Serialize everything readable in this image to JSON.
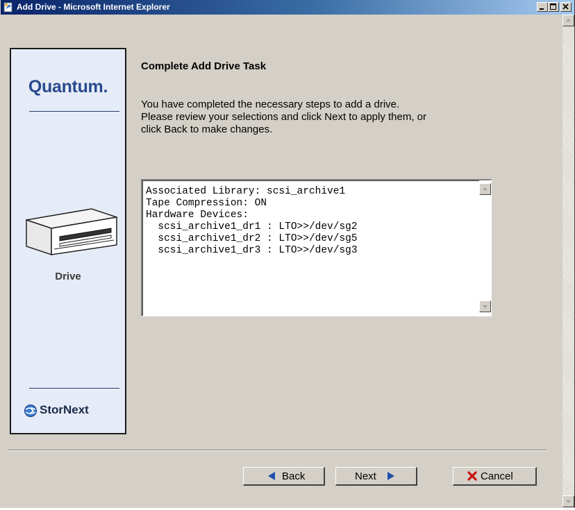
{
  "window": {
    "title": "Add Drive - Microsoft Internet Explorer"
  },
  "sidebar": {
    "brand": "Quantum.",
    "section_label": "Drive",
    "product": "StorNext"
  },
  "main": {
    "heading": "Complete Add Drive Task",
    "intro_lines": [
      "You have completed the necessary steps to add a drive.",
      "Please review your selections and click Next to apply them, or",
      "click Back to make changes."
    ],
    "summary_lines": [
      "Associated Library: scsi_archive1",
      "Tape Compression: ON",
      "Hardware Devices:",
      "  scsi_archive1_dr1 : LTO>>/dev/sg2",
      "  scsi_archive1_dr2 : LTO>>/dev/sg5",
      "  scsi_archive1_dr3 : LTO>>/dev/sg3"
    ]
  },
  "buttons": {
    "back": "Back",
    "next": "Next",
    "cancel": "Cancel"
  },
  "icons": {
    "title": "ie-page-icon",
    "back": "left-arrow-icon",
    "next": "right-arrow-icon",
    "cancel": "red-x-icon",
    "drive": "tape-drive-icon",
    "stornext": "stornext-globe-icon"
  },
  "colors": {
    "titlebar_start": "#0a246a",
    "titlebar_end": "#a6caf0",
    "panel_background": "#e6ecf7",
    "brand_blue": "#2a4a8c",
    "arrow_blue": "#1f4fa8",
    "cancel_red": "#cc1111"
  }
}
